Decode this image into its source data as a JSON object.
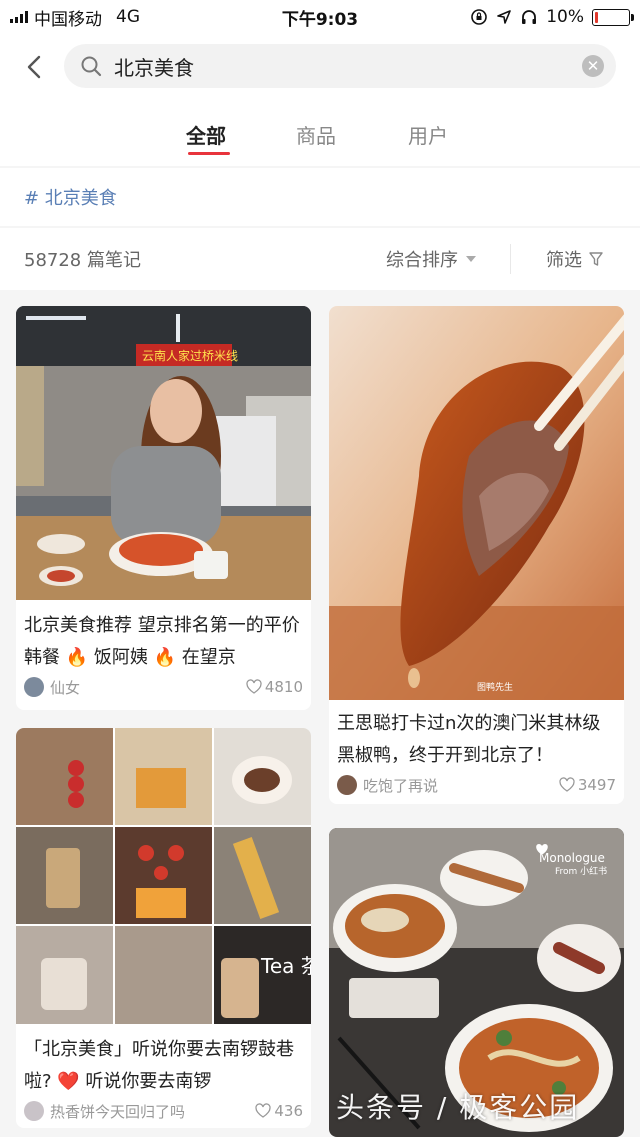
{
  "status_bar": {
    "carrier": "中国移动",
    "network": "4G",
    "time": "下午9:03",
    "battery": "10%",
    "battery_level": 0.1
  },
  "header": {
    "search_query": "北京美食",
    "tabs": [
      {
        "label": "全部",
        "active": true
      },
      {
        "label": "商品",
        "active": false
      },
      {
        "label": "用户",
        "active": false
      }
    ]
  },
  "topic": {
    "hashtag": "# 北京美食"
  },
  "toolbar": {
    "notes_count": "58728 篇笔记",
    "sort_label": "综合排序",
    "filter_label": "筛选"
  },
  "feed": [
    {
      "title": "北京美食推荐 望京排名第一的平价韩餐 🔥 饭阿姨 🔥 在望京",
      "author": "仙女",
      "likes": "4810",
      "image_icon": "korean-restaurant-photo"
    },
    {
      "title": "王思聪打卡过n次的澳门米其林级黑椒鸭，终于开到北京了！",
      "author": "吃饱了再说",
      "likes": "3497",
      "image_icon": "roast-duck-photo",
      "image_caption": "图鸭先生"
    },
    {
      "title": "「北京美食」听说你要去南锣鼓巷啦? ❤️ 听说你要去南锣",
      "author": "热香饼今天回归了吗",
      "likes": "436",
      "image_icon": "nanluoguxiang-collage-photo",
      "image_caption": "Tea 茶"
    },
    {
      "title": "",
      "author": "",
      "likes": "",
      "image_icon": "noodle-bowls-photo",
      "image_caption": "Monologue",
      "image_caption2": "From 小红书"
    }
  ],
  "watermark": "头条号 / 极客公园",
  "colors": {
    "accent": "#e8343c",
    "topic_link": "#5a7fb5"
  }
}
